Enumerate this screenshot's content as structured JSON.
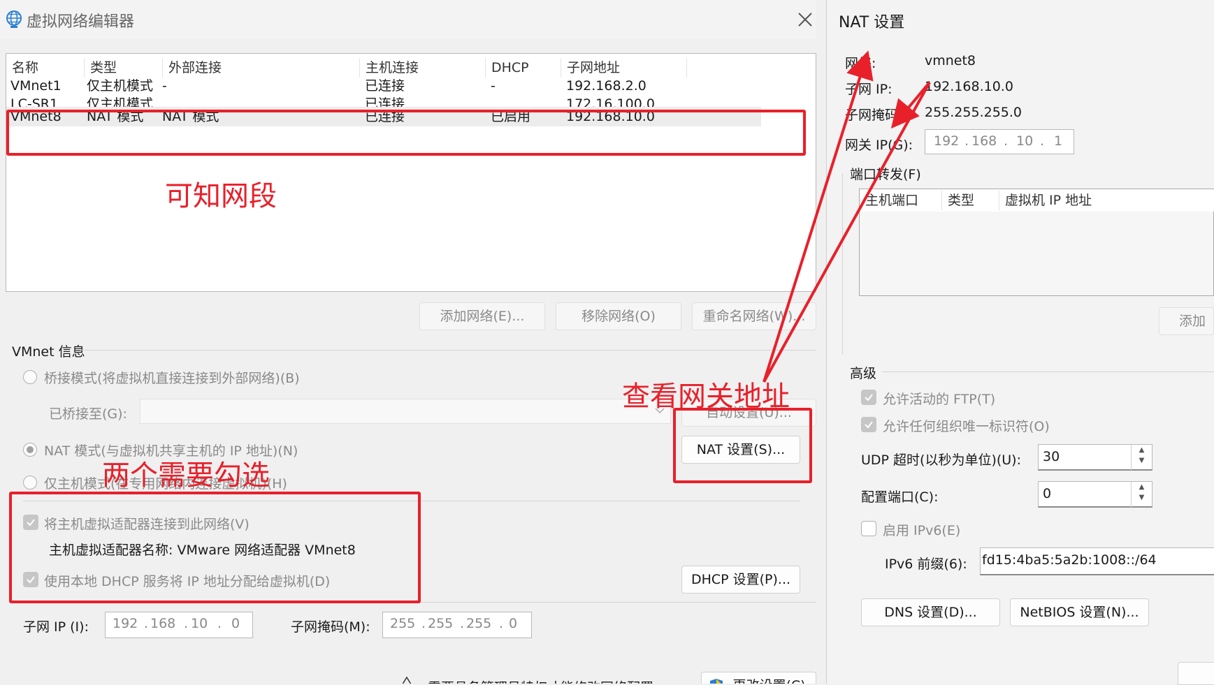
{
  "left": {
    "title": "虚拟网络编辑器",
    "table": {
      "headers": [
        "名称",
        "类型",
        "外部连接",
        "主机连接",
        "DHCP",
        "子网地址"
      ],
      "rows": [
        [
          "VMnet1",
          "仅主机模式",
          "-",
          "已连接",
          "-",
          "192.168.2.0"
        ],
        [
          "LC-SR1",
          "仅主机模式",
          "",
          "已连接",
          "",
          "172.16.100.0"
        ],
        [
          "VMnet8",
          "NAT 模式",
          "NAT 模式",
          "已连接",
          "已启用",
          "192.168.10.0"
        ]
      ]
    },
    "buttons": {
      "add_network": "添加网络(E)...",
      "remove_network": "移除网络(O)",
      "rename_network": "重命名网络(W)...",
      "auto_settings": "自动设置(U)...",
      "nat_settings": "NAT 设置(S)...",
      "dhcp_settings": "DHCP 设置(P)...",
      "change_settings": "更改设置(C)"
    },
    "vmnet_info": {
      "group_label": "VMnet 信息",
      "bridged": "桥接模式(将虚拟机直接连接到外部网络)(B)",
      "bridged_to": "已桥接至(G):",
      "nat": "NAT 模式(与虚拟机共享主机的 IP 地址)(N)",
      "host_only": "仅主机模式(在专用网络内连接虚拟机)(H)",
      "connect_adapter": "将主机虚拟适配器连接到此网络(V)",
      "adapter_name": "主机虚拟适配器名称: VMware 网络适配器 VMnet8",
      "use_dhcp": "使用本地 DHCP 服务将 IP 地址分配给虚拟机(D)",
      "subnet_ip_label": "子网 IP (I):",
      "subnet_ip": [
        "192",
        "168",
        "10",
        "0"
      ],
      "subnet_mask_label": "子网掩码(M):",
      "subnet_mask": [
        "255",
        "255",
        "255",
        "0"
      ],
      "admin_note": "需要具备管理员特权才能修改网络配置"
    }
  },
  "right": {
    "title": "NAT 设置",
    "network_label": "网络:",
    "network_value": "vmnet8",
    "subnet_ip_label": "子网 IP:",
    "subnet_ip_value": "192.168.10.0",
    "mask_label": "子网掩码:",
    "mask_value": "255.255.255.0",
    "gateway_label": "网关 IP(G):",
    "gateway_ip": [
      "192",
      "168",
      "10",
      "1"
    ],
    "port_forward_label": "端口转发(F)",
    "pf_headers": [
      "主机端口",
      "类型",
      "虚拟机 IP 地址"
    ],
    "add_button": "添加(A)",
    "advanced_label": "高级",
    "allow_ftp": "允许活动的 FTP(T)",
    "allow_oui": "允许任何组织唯一标识符(O)",
    "udp_label": "UDP 超时(以秒为单位)(U):",
    "udp_value": "30",
    "config_port_label": "配置端口(C):",
    "config_port_value": "0",
    "ipv6_label": "启用 IPv6(E)",
    "ipv6_prefix_label": "IPv6 前缀(6):",
    "ipv6_prefix_value": "fd15:4ba5:5a2b:1008::/64",
    "dns_button": "DNS 设置(D)...",
    "netbios_button": "NetBIOS 设置(N)..."
  },
  "annotations": {
    "segment": "可知网段",
    "gateway": "查看网关地址",
    "two_checks": "两个需要勾选"
  },
  "colors": {
    "annotation_red": "#e8202a"
  }
}
